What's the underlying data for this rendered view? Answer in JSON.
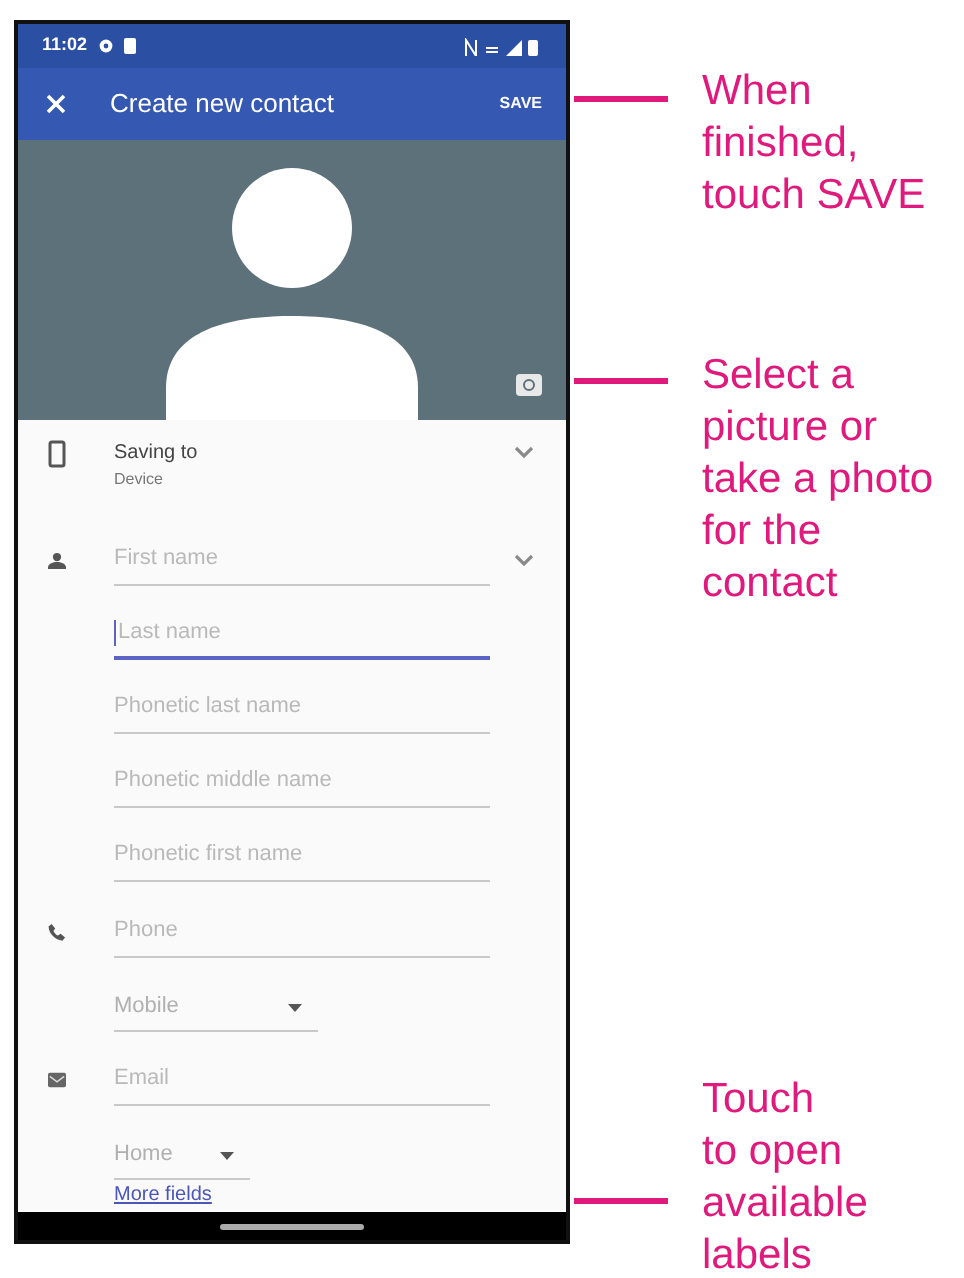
{
  "status_bar": {
    "time": "11:02"
  },
  "app_bar": {
    "title": "Create new contact",
    "action": "SAVE"
  },
  "saving_to": {
    "label": "Saving to",
    "account": "Device"
  },
  "name_fields": [
    {
      "placeholder": "First name",
      "focused": false
    },
    {
      "placeholder": "Last name",
      "focused": true
    },
    {
      "placeholder": "Phonetic last name",
      "focused": false
    },
    {
      "placeholder": "Phonetic middle name",
      "focused": false
    },
    {
      "placeholder": "Phonetic first name",
      "focused": false
    }
  ],
  "phone": {
    "field": {
      "placeholder": "Phone",
      "focused": false
    },
    "label_type": "Mobile"
  },
  "email": {
    "field": {
      "placeholder": "Email",
      "focused": false
    },
    "label_type": "Home"
  },
  "more_fields": "More fields",
  "callouts": [
    {
      "lines": [
        "When",
        "finished,",
        "touch SAVE"
      ]
    },
    {
      "lines": [
        "Select a",
        "picture or",
        "take a photo",
        "for the",
        "contact"
      ]
    },
    {
      "lines": [
        "Touch",
        "to open",
        "available",
        "labels"
      ]
    }
  ]
}
